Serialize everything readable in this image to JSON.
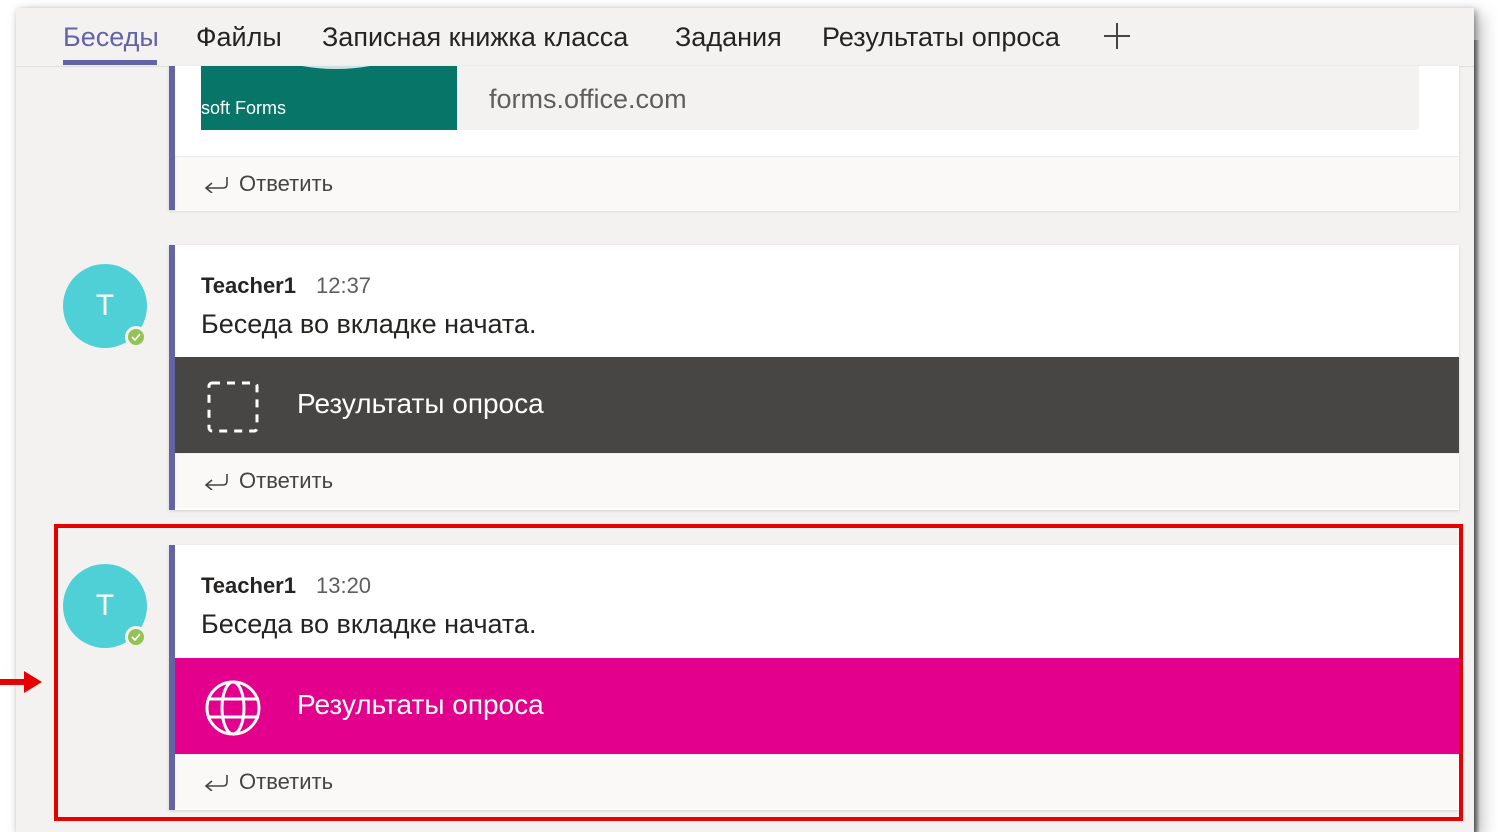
{
  "tabs": {
    "items": [
      {
        "label": "Беседы",
        "active": true
      },
      {
        "label": "Файлы"
      },
      {
        "label": "Записная книжка класса"
      },
      {
        "label": "Задания"
      },
      {
        "label": "Результаты опроса"
      }
    ],
    "add_icon": "plus-icon"
  },
  "posts": [
    {
      "preview": {
        "thumb_text": "soft Forms",
        "domain": "forms.office.com",
        "thumb_color": "#077568"
      },
      "reply_label": "Ответить"
    },
    {
      "avatar_letter": "T",
      "author": "Teacher1",
      "time": "12:37",
      "message": "Беседа во вкладке начата.",
      "tab_card": {
        "label": "Результаты опроса",
        "icon": "dashed-square-icon",
        "color": "#484644"
      },
      "reply_label": "Ответить"
    },
    {
      "avatar_letter": "T",
      "author": "Teacher1",
      "time": "13:20",
      "message": "Беседа во вкладке начата.",
      "tab_card": {
        "label": "Результаты опроса",
        "icon": "globe-icon",
        "color": "#e3008c"
      },
      "reply_label": "Ответить"
    }
  ],
  "colors": {
    "accent": "#6264a7",
    "avatar": "#4fd0d6",
    "presence": "#92c353",
    "highlight": "#e60000"
  }
}
